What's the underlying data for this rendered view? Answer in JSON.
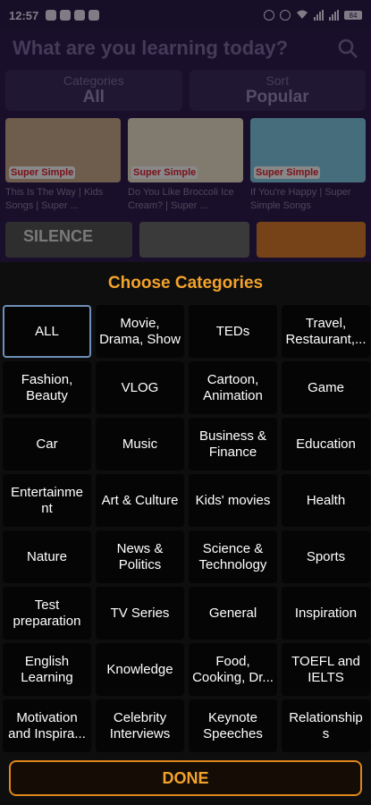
{
  "status_bar": {
    "time": "12:57",
    "battery": "84"
  },
  "search": {
    "placeholder": "What are you learning today?"
  },
  "filters": {
    "categories": {
      "label": "Categories",
      "value": "All"
    },
    "sort": {
      "label": "Sort",
      "value": "Popular"
    }
  },
  "videos": [
    {
      "title": "This Is The Way | Kids Songs | Super ...",
      "sticker": "Super Simple",
      "thumb_color": "#c9a88a"
    },
    {
      "title": "Do You Like Broccoli Ice Cream? | Super ...",
      "sticker": "Super Simple",
      "thumb_color": "#e9e1c9"
    },
    {
      "title": "If You're Happy | Super Simple Songs",
      "sticker": "Super Simple",
      "thumb_color": "#7ec6e2"
    }
  ],
  "row2_thumbs": [
    {
      "label": "SILENCE",
      "color": "#555555"
    },
    {
      "label": "",
      "color": "#6a6a6a"
    },
    {
      "label": "",
      "color": "#d77a2e"
    }
  ],
  "sheet": {
    "title": "Choose Categories",
    "done_label": "DONE",
    "accent": "#f3a22b",
    "categories": [
      "ALL",
      "Movie, Drama, Show",
      "TEDs",
      "Travel, Restaurant,...",
      "Fashion, Beauty",
      "VLOG",
      "Cartoon, Animation",
      "Game",
      "Car",
      "Music",
      "Business & Finance",
      "Education",
      "Entertainme nt",
      "Art & Culture",
      "Kids' movies",
      "Health",
      "Nature",
      "News & Politics",
      "Science & Technology",
      "Sports",
      "Test preparation",
      "TV Series",
      "General",
      "Inspiration",
      "English Learning",
      "Knowledge",
      "Food, Cooking, Dr...",
      "TOEFL and IELTS",
      "Motivation and Inspira...",
      "Celebrity Interviews",
      "Keynote Speeches",
      "Relationship s"
    ],
    "selected_index": 0
  }
}
